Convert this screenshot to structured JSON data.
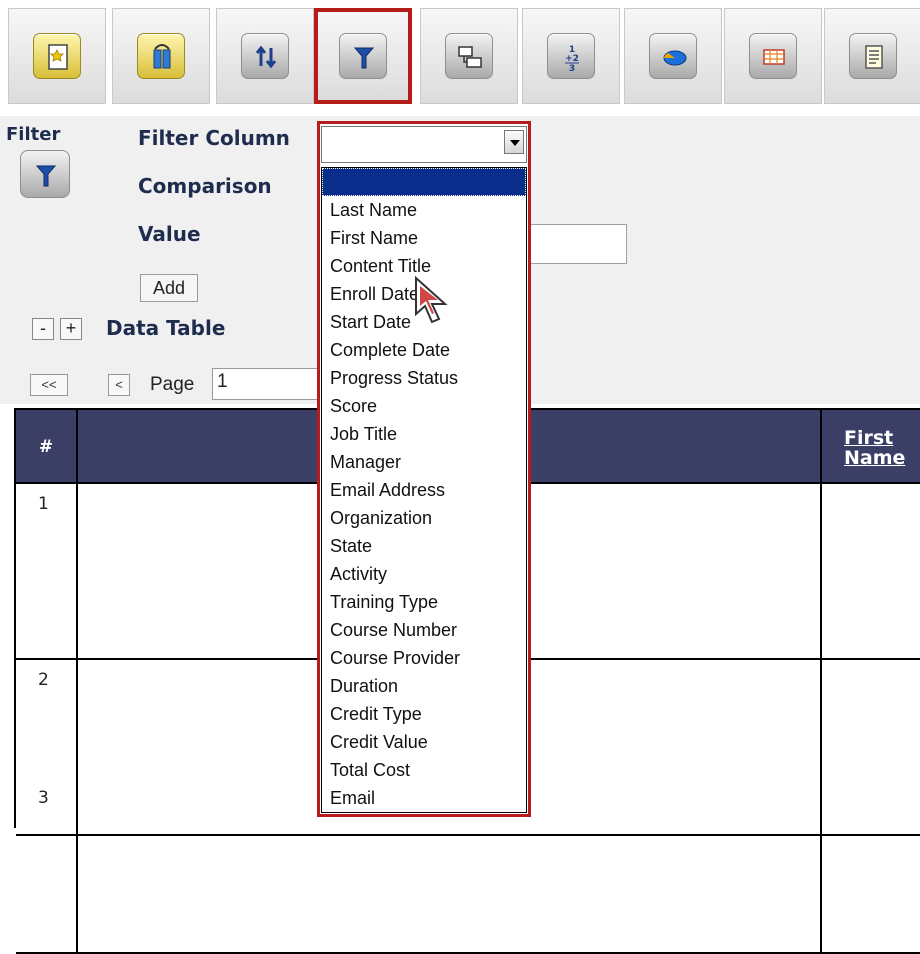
{
  "toolbar": {
    "buttons": [
      {
        "name": "page-icon"
      },
      {
        "name": "columns-icon"
      },
      {
        "name": "sort-icon"
      },
      {
        "name": "filter-icon",
        "active": true
      },
      {
        "name": "group-icon"
      },
      {
        "name": "subtotal-icon"
      },
      {
        "name": "chart-icon"
      },
      {
        "name": "grid-icon"
      },
      {
        "name": "report-icon"
      }
    ]
  },
  "filter": {
    "title": "Filter",
    "column_label": "Filter Column",
    "comparison_label": "Comparison",
    "value_label": "Value",
    "add_label": "Add",
    "column_value": ""
  },
  "dropdown": {
    "options": [
      "",
      "Last Name",
      "First Name",
      "Content Title",
      "Enroll Date",
      "Start Date",
      "Complete Date",
      "Progress Status",
      "Score",
      "Job Title",
      "Manager",
      "Email Address",
      "Organization",
      "State",
      "Activity",
      "Training Type",
      "Course Number",
      "Course Provider",
      "Duration",
      "Credit Type",
      "Credit Value",
      "Total Cost",
      "Email"
    ],
    "selected_index": 0
  },
  "data_table": {
    "title": "Data Table",
    "collapse_label": "-",
    "expand_label": "+",
    "first_label": "<<",
    "prev_label": "<",
    "page_label": "Page",
    "page_value": "1"
  },
  "grid": {
    "header_num": "#",
    "header_first_line1": "First",
    "header_first_line2": "Name",
    "rows": [
      "1",
      "2",
      "3"
    ]
  },
  "colors": {
    "accent_red": "#b71c1c",
    "header_navy": "#3b3f66",
    "selection_blue": "#0a2c8a"
  }
}
